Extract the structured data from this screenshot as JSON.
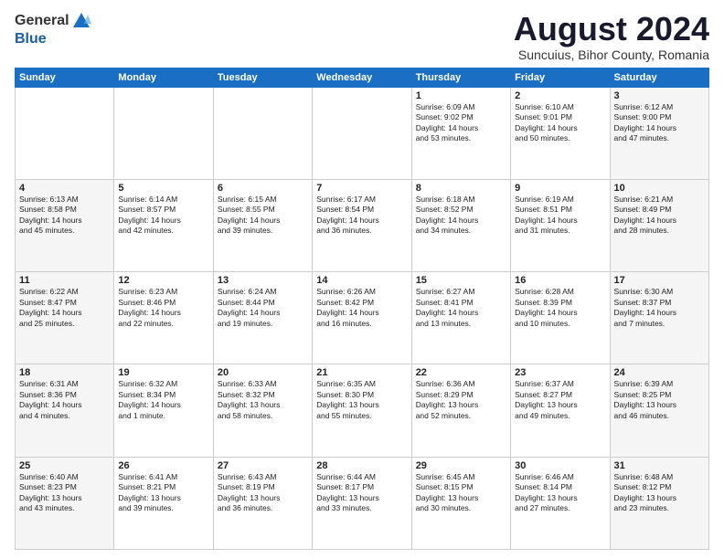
{
  "header": {
    "logo_general": "General",
    "logo_blue": "Blue",
    "month_year": "August 2024",
    "location": "Suncuius, Bihor County, Romania"
  },
  "days_of_week": [
    "Sunday",
    "Monday",
    "Tuesday",
    "Wednesday",
    "Thursday",
    "Friday",
    "Saturday"
  ],
  "weeks": [
    [
      {
        "day": "",
        "info": ""
      },
      {
        "day": "",
        "info": ""
      },
      {
        "day": "",
        "info": ""
      },
      {
        "day": "",
        "info": ""
      },
      {
        "day": "1",
        "info": "Sunrise: 6:09 AM\nSunset: 9:02 PM\nDaylight: 14 hours\nand 53 minutes."
      },
      {
        "day": "2",
        "info": "Sunrise: 6:10 AM\nSunset: 9:01 PM\nDaylight: 14 hours\nand 50 minutes."
      },
      {
        "day": "3",
        "info": "Sunrise: 6:12 AM\nSunset: 9:00 PM\nDaylight: 14 hours\nand 47 minutes."
      }
    ],
    [
      {
        "day": "4",
        "info": "Sunrise: 6:13 AM\nSunset: 8:58 PM\nDaylight: 14 hours\nand 45 minutes."
      },
      {
        "day": "5",
        "info": "Sunrise: 6:14 AM\nSunset: 8:57 PM\nDaylight: 14 hours\nand 42 minutes."
      },
      {
        "day": "6",
        "info": "Sunrise: 6:15 AM\nSunset: 8:55 PM\nDaylight: 14 hours\nand 39 minutes."
      },
      {
        "day": "7",
        "info": "Sunrise: 6:17 AM\nSunset: 8:54 PM\nDaylight: 14 hours\nand 36 minutes."
      },
      {
        "day": "8",
        "info": "Sunrise: 6:18 AM\nSunset: 8:52 PM\nDaylight: 14 hours\nand 34 minutes."
      },
      {
        "day": "9",
        "info": "Sunrise: 6:19 AM\nSunset: 8:51 PM\nDaylight: 14 hours\nand 31 minutes."
      },
      {
        "day": "10",
        "info": "Sunrise: 6:21 AM\nSunset: 8:49 PM\nDaylight: 14 hours\nand 28 minutes."
      }
    ],
    [
      {
        "day": "11",
        "info": "Sunrise: 6:22 AM\nSunset: 8:47 PM\nDaylight: 14 hours\nand 25 minutes."
      },
      {
        "day": "12",
        "info": "Sunrise: 6:23 AM\nSunset: 8:46 PM\nDaylight: 14 hours\nand 22 minutes."
      },
      {
        "day": "13",
        "info": "Sunrise: 6:24 AM\nSunset: 8:44 PM\nDaylight: 14 hours\nand 19 minutes."
      },
      {
        "day": "14",
        "info": "Sunrise: 6:26 AM\nSunset: 8:42 PM\nDaylight: 14 hours\nand 16 minutes."
      },
      {
        "day": "15",
        "info": "Sunrise: 6:27 AM\nSunset: 8:41 PM\nDaylight: 14 hours\nand 13 minutes."
      },
      {
        "day": "16",
        "info": "Sunrise: 6:28 AM\nSunset: 8:39 PM\nDaylight: 14 hours\nand 10 minutes."
      },
      {
        "day": "17",
        "info": "Sunrise: 6:30 AM\nSunset: 8:37 PM\nDaylight: 14 hours\nand 7 minutes."
      }
    ],
    [
      {
        "day": "18",
        "info": "Sunrise: 6:31 AM\nSunset: 8:36 PM\nDaylight: 14 hours\nand 4 minutes."
      },
      {
        "day": "19",
        "info": "Sunrise: 6:32 AM\nSunset: 8:34 PM\nDaylight: 14 hours\nand 1 minute."
      },
      {
        "day": "20",
        "info": "Sunrise: 6:33 AM\nSunset: 8:32 PM\nDaylight: 13 hours\nand 58 minutes."
      },
      {
        "day": "21",
        "info": "Sunrise: 6:35 AM\nSunset: 8:30 PM\nDaylight: 13 hours\nand 55 minutes."
      },
      {
        "day": "22",
        "info": "Sunrise: 6:36 AM\nSunset: 8:29 PM\nDaylight: 13 hours\nand 52 minutes."
      },
      {
        "day": "23",
        "info": "Sunrise: 6:37 AM\nSunset: 8:27 PM\nDaylight: 13 hours\nand 49 minutes."
      },
      {
        "day": "24",
        "info": "Sunrise: 6:39 AM\nSunset: 8:25 PM\nDaylight: 13 hours\nand 46 minutes."
      }
    ],
    [
      {
        "day": "25",
        "info": "Sunrise: 6:40 AM\nSunset: 8:23 PM\nDaylight: 13 hours\nand 43 minutes."
      },
      {
        "day": "26",
        "info": "Sunrise: 6:41 AM\nSunset: 8:21 PM\nDaylight: 13 hours\nand 39 minutes."
      },
      {
        "day": "27",
        "info": "Sunrise: 6:43 AM\nSunset: 8:19 PM\nDaylight: 13 hours\nand 36 minutes."
      },
      {
        "day": "28",
        "info": "Sunrise: 6:44 AM\nSunset: 8:17 PM\nDaylight: 13 hours\nand 33 minutes."
      },
      {
        "day": "29",
        "info": "Sunrise: 6:45 AM\nSunset: 8:15 PM\nDaylight: 13 hours\nand 30 minutes."
      },
      {
        "day": "30",
        "info": "Sunrise: 6:46 AM\nSunset: 8:14 PM\nDaylight: 13 hours\nand 27 minutes."
      },
      {
        "day": "31",
        "info": "Sunrise: 6:48 AM\nSunset: 8:12 PM\nDaylight: 13 hours\nand 23 minutes."
      }
    ]
  ]
}
